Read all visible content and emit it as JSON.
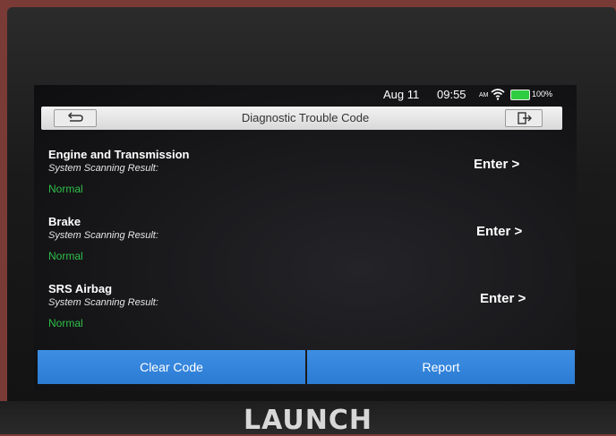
{
  "device": {
    "brand": "LAUNCH"
  },
  "status_bar": {
    "date": "Aug 11",
    "time": "09:55",
    "ampm": "AM",
    "battery": "100%"
  },
  "titlebar": {
    "title": "Diagnostic Trouble Code"
  },
  "systems": [
    {
      "name": "Engine and Transmission",
      "scan_label": "System Scanning Result:",
      "status": "Normal",
      "enter_label": "Enter >"
    },
    {
      "name": "Brake",
      "scan_label": "System Scanning Result:",
      "status": "Normal",
      "enter_label": "Enter >"
    },
    {
      "name": "SRS Airbag",
      "scan_label": "System Scanning Result:",
      "status": "Normal",
      "enter_label": "Enter >"
    }
  ],
  "bottom_bar": {
    "clear_label": "Clear Code",
    "report_label": "Report"
  },
  "colors": {
    "accent": "#2c7bd4",
    "status_ok": "#2fbf4a"
  },
  "icons": {
    "back": "back-arrow-icon",
    "exit": "exit-icon",
    "wifi": "wifi-icon",
    "battery": "battery-icon"
  }
}
